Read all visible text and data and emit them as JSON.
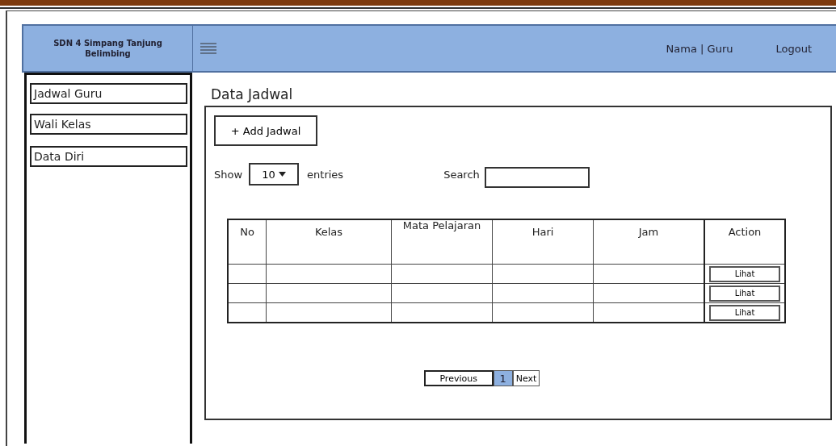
{
  "header": {
    "brand": "SDN 4 Simpang Tanjung Belimbing",
    "user": "Nama | Guru",
    "logout": "Logout"
  },
  "sidebar": {
    "items": [
      {
        "label": "Jadwal Guru"
      },
      {
        "label": "Wali Kelas"
      },
      {
        "label": "Data Diri"
      }
    ]
  },
  "page_title": "Data Jadwal",
  "add_button": "+ Add Jadwal",
  "length": {
    "prefix": "Show",
    "value": "10",
    "suffix": "entries"
  },
  "search": {
    "label": "Search"
  },
  "table": {
    "columns": [
      "No",
      "Kelas",
      "Mata Pelajaran",
      "Hari",
      "Jam",
      "Action"
    ],
    "rows": [
      {
        "action": "Lihat"
      },
      {
        "action": "Lihat"
      },
      {
        "action": "Lihat"
      }
    ]
  },
  "pagination": {
    "previous": "Previous",
    "pages": [
      {
        "label": "1",
        "selected": true
      }
    ],
    "next": "Next"
  }
}
